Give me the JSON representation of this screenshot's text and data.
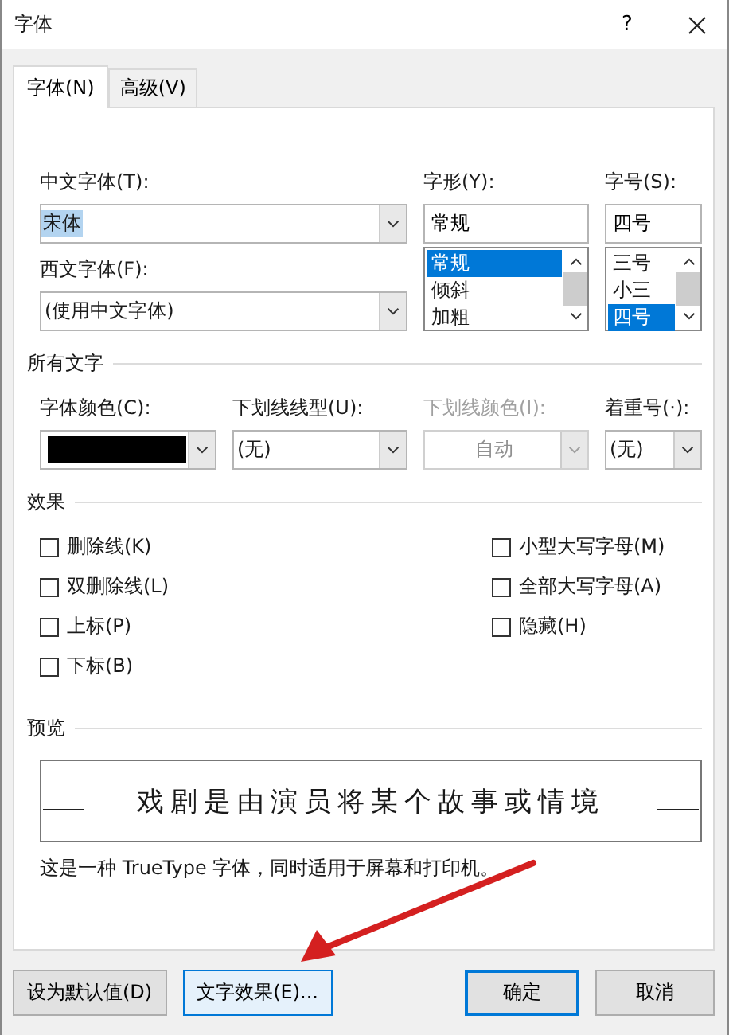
{
  "window": {
    "title": "字体",
    "help": "?"
  },
  "tabs": [
    {
      "label": "字体(N)",
      "selected": true
    },
    {
      "label": "高级(V)",
      "selected": false
    }
  ],
  "font": {
    "chinese_font": {
      "label": "中文字体(T):",
      "value": "宋体",
      "value_selected": true
    },
    "western_font": {
      "label": "西文字体(F):",
      "value": "(使用中文字体)"
    },
    "style": {
      "label": "字形(Y):",
      "value": "常规",
      "options": [
        {
          "label": "常规",
          "selected": true
        },
        {
          "label": "倾斜",
          "selected": false
        },
        {
          "label": "加粗",
          "selected": false
        }
      ]
    },
    "size": {
      "label": "字号(S):",
      "value": "四号",
      "options": [
        {
          "label": "三号",
          "selected": false
        },
        {
          "label": "小三",
          "selected": false
        },
        {
          "label": "四号",
          "selected": true
        }
      ]
    }
  },
  "all_text": {
    "heading": "所有文字",
    "controls": [
      {
        "kind": "color",
        "label": "字体颜色(C):",
        "color": "#000000",
        "disabled": false
      },
      {
        "kind": "dropdown",
        "label": "下划线线型(U):",
        "value": "(无)",
        "disabled": false
      },
      {
        "kind": "dropdown",
        "label": "下划线颜色(I):",
        "value": "自动",
        "disabled": true
      },
      {
        "kind": "dropdown",
        "label": "着重号(·):",
        "value": "(无)",
        "disabled": false
      }
    ]
  },
  "effects": {
    "heading": "效果",
    "left": [
      {
        "label": "删除线(K)",
        "checked": false
      },
      {
        "label": "双删除线(L)",
        "checked": false
      },
      {
        "label": "上标(P)",
        "checked": false
      },
      {
        "label": "下标(B)",
        "checked": false
      }
    ],
    "right": [
      {
        "label": "小型大写字母(M)",
        "checked": false
      },
      {
        "label": "全部大写字母(A)",
        "checked": false
      },
      {
        "label": "隐藏(H)",
        "checked": false
      }
    ]
  },
  "preview": {
    "heading": "预览",
    "sample": "戏剧是由演员将某个故事或情境",
    "description": "这是一种 TrueType 字体，同时适用于屏幕和打印机。"
  },
  "buttons": [
    {
      "label": "设为默认值(D)",
      "default": false,
      "hovered": false
    },
    {
      "label": "文字效果(E)...",
      "default": false,
      "hovered": true
    },
    {
      "label": "确定",
      "default": true,
      "hovered": false
    },
    {
      "label": "取消",
      "default": false,
      "hovered": false
    }
  ],
  "annotation": {
    "kind": "arrow"
  }
}
